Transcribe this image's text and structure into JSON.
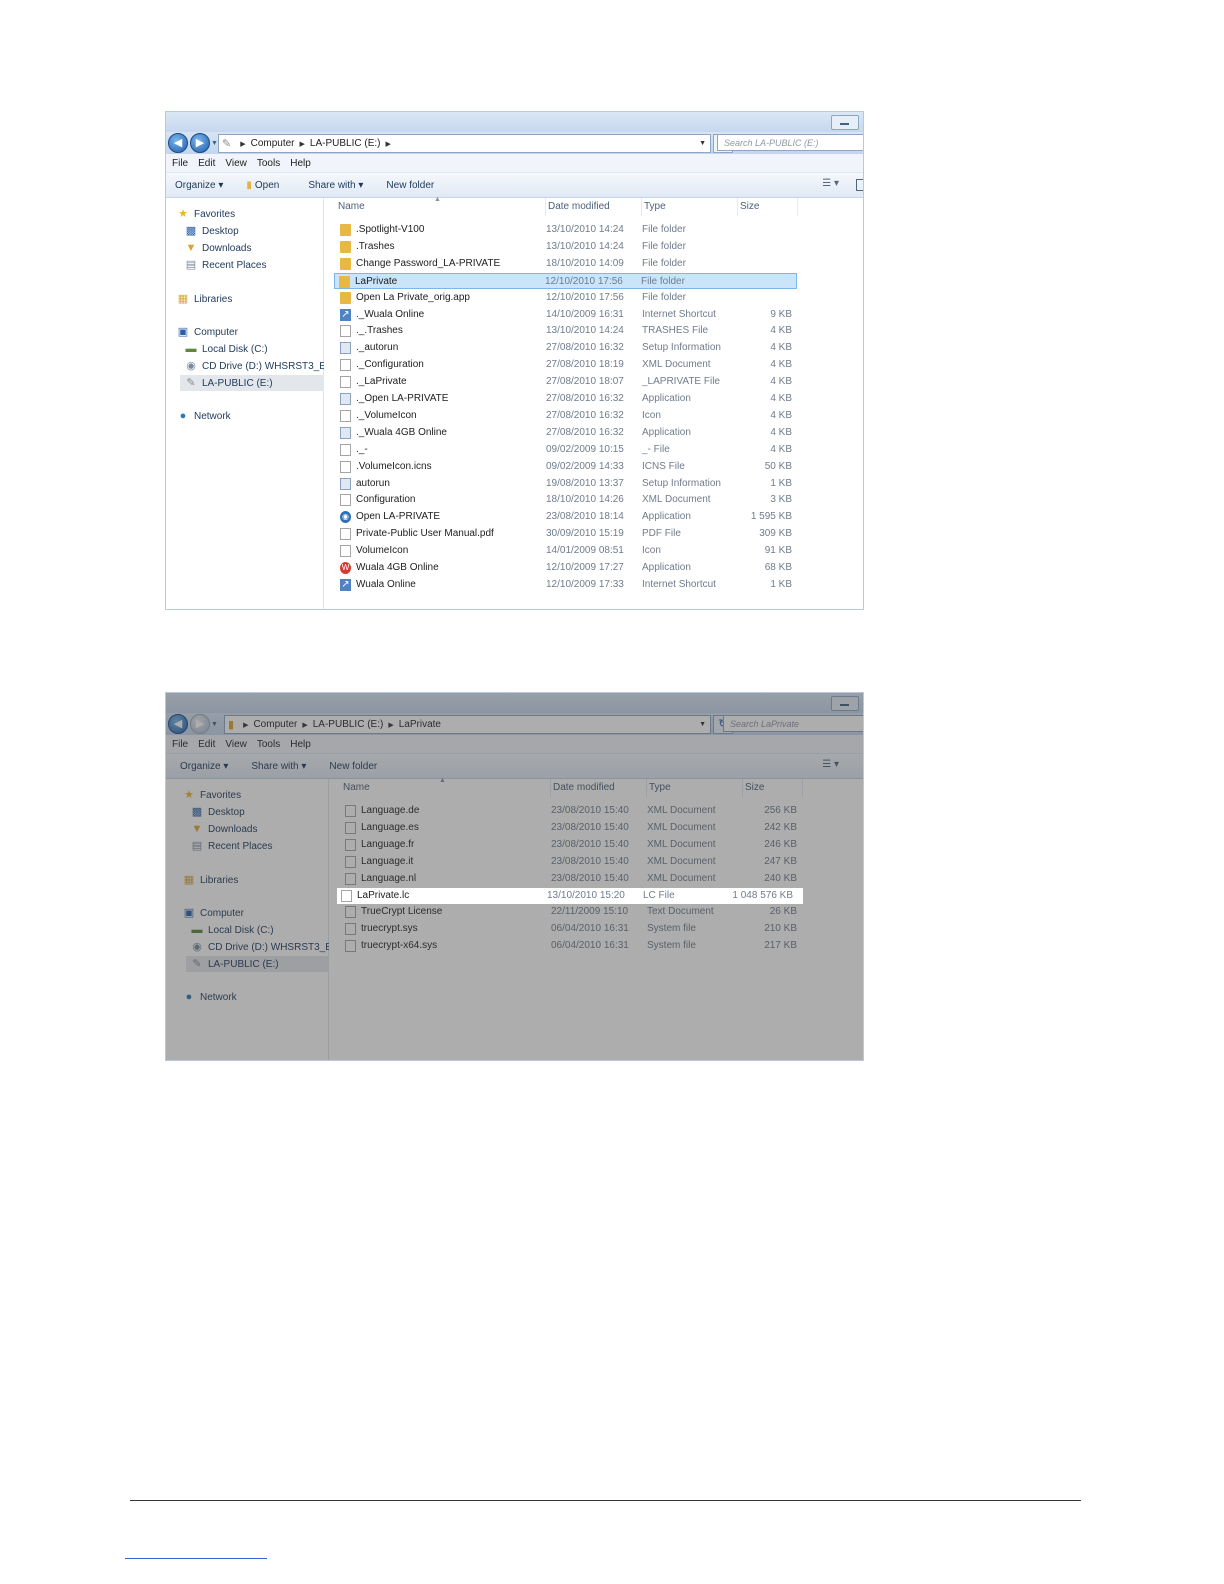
{
  "window1": {
    "breadcrumb": [
      "Computer",
      "LA-PUBLIC (E:)"
    ],
    "search_placeholder": "Search LA-PUBLIC (E:)",
    "menu": [
      "File",
      "Edit",
      "View",
      "Tools",
      "Help"
    ],
    "toolbar": {
      "organize": "Organize ▾",
      "open": "Open",
      "share": "Share with ▾",
      "new_folder": "New folder"
    },
    "columns": {
      "name": "Name",
      "date": "Date modified",
      "type": "Type",
      "size": "Size"
    },
    "nav": {
      "favorites": "Favorites",
      "desktop": "Desktop",
      "downloads": "Downloads",
      "recent": "Recent Places",
      "libraries": "Libraries",
      "computer": "Computer",
      "local_disk": "Local Disk (C:)",
      "cd_drive": "CD Drive (D:) WHSRST3_EN",
      "la_public": "LA-PUBLIC (E:)",
      "network": "Network"
    },
    "files": [
      {
        "name": ".Spotlight-V100",
        "date": "13/10/2010 14:24",
        "type": "File folder",
        "size": "",
        "icon": "folder"
      },
      {
        "name": ".Trashes",
        "date": "13/10/2010 14:24",
        "type": "File folder",
        "size": "",
        "icon": "folder"
      },
      {
        "name": "Change Password_LA-PRIVATE",
        "date": "18/10/2010 14:09",
        "type": "File folder",
        "size": "",
        "icon": "folder"
      },
      {
        "name": "LaPrivate",
        "date": "12/10/2010 17:56",
        "type": "File folder",
        "size": "",
        "icon": "folder"
      },
      {
        "name": "Open La Private_orig.app",
        "date": "12/10/2010 17:56",
        "type": "File folder",
        "size": "",
        "icon": "folder"
      },
      {
        "name": "._Wuala Online",
        "date": "14/10/2009 16:31",
        "type": "Internet Shortcut",
        "size": "9 KB",
        "icon": "url"
      },
      {
        "name": "._.Trashes",
        "date": "13/10/2010 14:24",
        "type": "TRASHES File",
        "size": "4 KB",
        "icon": "doc"
      },
      {
        "name": "._autorun",
        "date": "27/08/2010 16:32",
        "type": "Setup Information",
        "size": "4 KB",
        "icon": "app"
      },
      {
        "name": "._Configuration",
        "date": "27/08/2010 18:19",
        "type": "XML Document",
        "size": "4 KB",
        "icon": "doc"
      },
      {
        "name": "._LaPrivate",
        "date": "27/08/2010 18:07",
        "type": "_LAPRIVATE File",
        "size": "4 KB",
        "icon": "doc"
      },
      {
        "name": "._Open LA-PRIVATE",
        "date": "27/08/2010 16:32",
        "type": "Application",
        "size": "4 KB",
        "icon": "app"
      },
      {
        "name": "._VolumeIcon",
        "date": "27/08/2010 16:32",
        "type": "Icon",
        "size": "4 KB",
        "icon": "doc"
      },
      {
        "name": "._Wuala 4GB Online",
        "date": "27/08/2010 16:32",
        "type": "Application",
        "size": "4 KB",
        "icon": "app"
      },
      {
        "name": "._-",
        "date": "09/02/2009 10:15",
        "type": "_- File",
        "size": "4 KB",
        "icon": "doc"
      },
      {
        "name": ".VolumeIcon.icns",
        "date": "09/02/2009 14:33",
        "type": "ICNS File",
        "size": "50 KB",
        "icon": "doc"
      },
      {
        "name": "autorun",
        "date": "19/08/2010 13:37",
        "type": "Setup Information",
        "size": "1 KB",
        "icon": "app"
      },
      {
        "name": "Configuration",
        "date": "18/10/2010 14:26",
        "type": "XML Document",
        "size": "3 KB",
        "icon": "doc"
      },
      {
        "name": "Open LA-PRIVATE",
        "date": "23/08/2010 18:14",
        "type": "Application",
        "size": "1 595 KB",
        "icon": "cd"
      },
      {
        "name": "Private-Public User Manual.pdf",
        "date": "30/09/2010 15:19",
        "type": "PDF File",
        "size": "309 KB",
        "icon": "doc"
      },
      {
        "name": "VolumeIcon",
        "date": "14/01/2009 08:51",
        "type": "Icon",
        "size": "91 KB",
        "icon": "doc"
      },
      {
        "name": "Wuala 4GB Online",
        "date": "12/10/2009 17:27",
        "type": "Application",
        "size": "68 KB",
        "icon": "wuala"
      },
      {
        "name": "Wuala Online",
        "date": "12/10/2009 17:33",
        "type": "Internet Shortcut",
        "size": "1 KB",
        "icon": "url"
      }
    ],
    "selected_index": 3
  },
  "window2": {
    "breadcrumb": [
      "Computer",
      "LA-PUBLIC (E:)",
      "LaPrivate"
    ],
    "search_placeholder": "Search LaPrivate",
    "menu": [
      "File",
      "Edit",
      "View",
      "Tools",
      "Help"
    ],
    "toolbar": {
      "organize": "Organize ▾",
      "share": "Share with ▾",
      "new_folder": "New folder"
    },
    "columns": {
      "name": "Name",
      "date": "Date modified",
      "type": "Type",
      "size": "Size"
    },
    "nav": {
      "favorites": "Favorites",
      "desktop": "Desktop",
      "downloads": "Downloads",
      "recent": "Recent Places",
      "libraries": "Libraries",
      "computer": "Computer",
      "local_disk": "Local Disk (C:)",
      "cd_drive": "CD Drive (D:) WHSRST3_EN",
      "la_public": "LA-PUBLIC (E:)",
      "network": "Network"
    },
    "files": [
      {
        "name": "Language.de",
        "date": "23/08/2010 15:40",
        "type": "XML Document",
        "size": "256 KB",
        "icon": "doc"
      },
      {
        "name": "Language.es",
        "date": "23/08/2010 15:40",
        "type": "XML Document",
        "size": "242 KB",
        "icon": "doc"
      },
      {
        "name": "Language.fr",
        "date": "23/08/2010 15:40",
        "type": "XML Document",
        "size": "246 KB",
        "icon": "doc"
      },
      {
        "name": "Language.it",
        "date": "23/08/2010 15:40",
        "type": "XML Document",
        "size": "247 KB",
        "icon": "doc"
      },
      {
        "name": "Language.nl",
        "date": "23/08/2010 15:40",
        "type": "XML Document",
        "size": "240 KB",
        "icon": "doc"
      },
      {
        "name": "LaPrivate.lc",
        "date": "13/10/2010 15:20",
        "type": "LC File",
        "size": "1 048 576 KB",
        "icon": "doc"
      },
      {
        "name": "TrueCrypt License",
        "date": "22/11/2009 15:10",
        "type": "Text Document",
        "size": "26 KB",
        "icon": "doc"
      },
      {
        "name": "truecrypt.sys",
        "date": "06/04/2010 16:31",
        "type": "System file",
        "size": "210 KB",
        "icon": "doc"
      },
      {
        "name": "truecrypt-x64.sys",
        "date": "06/04/2010 16:31",
        "type": "System file",
        "size": "217 KB",
        "icon": "doc"
      }
    ],
    "highlighted_index": 5
  }
}
